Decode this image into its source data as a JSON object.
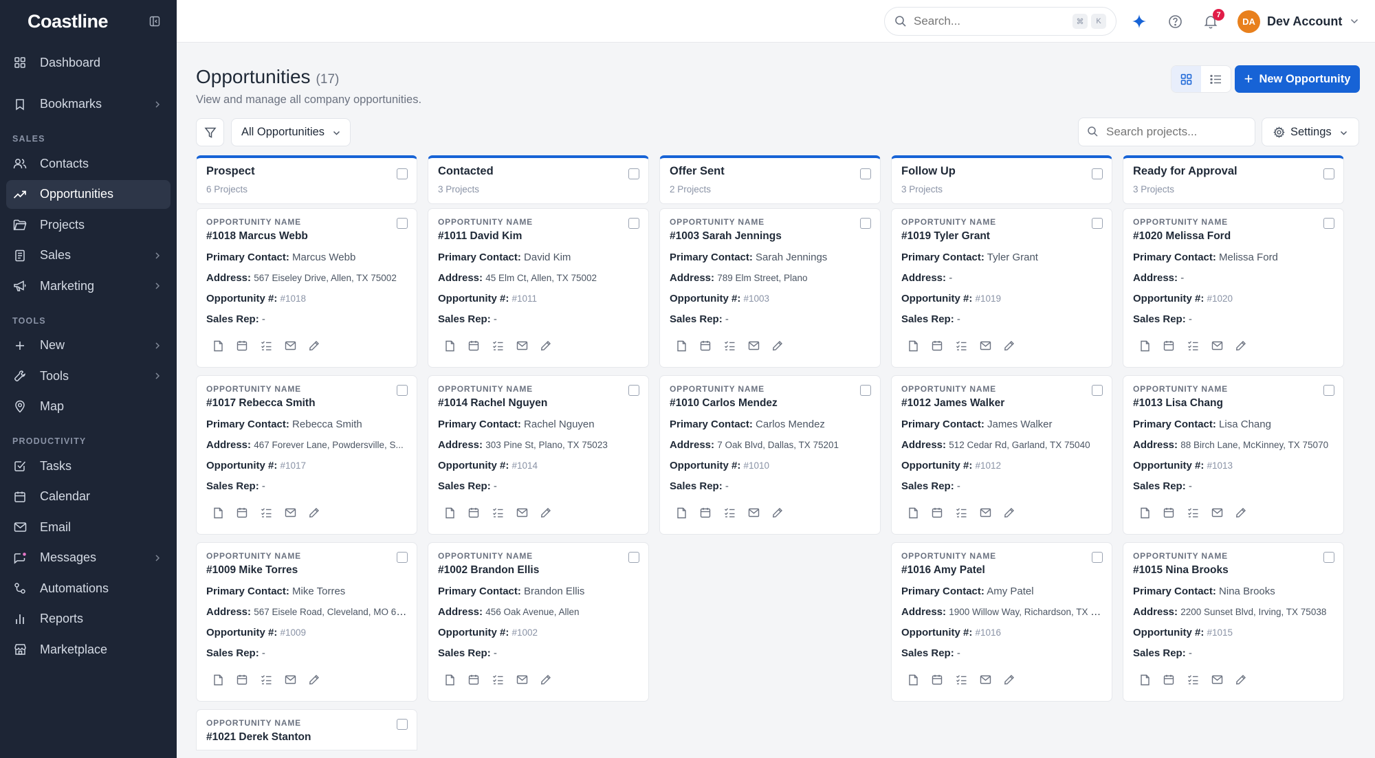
{
  "brand": {
    "name": "Coastline"
  },
  "sidebar": {
    "items_top": [
      {
        "label": "Dashboard",
        "icon": "grid-icon"
      },
      {
        "label": "Bookmarks",
        "icon": "bookmark-icon"
      }
    ],
    "section_sales": "SALES",
    "items_sales": [
      {
        "label": "Contacts",
        "icon": "users-icon"
      },
      {
        "label": "Opportunities",
        "icon": "trend-icon"
      },
      {
        "label": "Projects",
        "icon": "folder-icon"
      },
      {
        "label": "Sales",
        "icon": "receipt-icon"
      },
      {
        "label": "Marketing",
        "icon": "megaphone-icon"
      }
    ],
    "section_tools": "TOOLS",
    "items_tools": [
      {
        "label": "New",
        "icon": "plus-icon"
      },
      {
        "label": "Tools",
        "icon": "wrench-icon"
      },
      {
        "label": "Map",
        "icon": "map-pin-icon"
      }
    ],
    "section_productivity": "PRODUCTIVITY",
    "items_productivity": [
      {
        "label": "Tasks",
        "icon": "check-square-icon"
      },
      {
        "label": "Calendar",
        "icon": "calendar-icon"
      },
      {
        "label": "Email",
        "icon": "mail-icon"
      },
      {
        "label": "Messages",
        "icon": "message-icon"
      },
      {
        "label": "Automations",
        "icon": "automation-icon"
      },
      {
        "label": "Reports",
        "icon": "bar-chart-icon"
      },
      {
        "label": "Marketplace",
        "icon": "store-icon"
      }
    ]
  },
  "topbar": {
    "search_placeholder": "Search...",
    "kbd1": "⌘",
    "kbd2": "K",
    "notification_count": "7",
    "avatar_initials": "DA",
    "account_name": "Dev Account"
  },
  "page": {
    "title": "Opportunities",
    "count": "(17)",
    "subtitle": "View and manage all company opportunities.",
    "new_button": "New Opportunity",
    "filter_value": "All Opportunities",
    "project_search_placeholder": "Search projects...",
    "settings_label": "Settings"
  },
  "card_labels": {
    "kicker": "OPPORTUNITY NAME",
    "primary_contact": "Primary Contact:",
    "address": "Address:",
    "opportunity_no": "Opportunity #:",
    "sales_rep": "Sales Rep:"
  },
  "columns": [
    {
      "title": "Prospect",
      "count": "6 Projects",
      "cards": [
        {
          "name": "#1018 Marcus Webb",
          "contact": "Marcus Webb",
          "address": "567 Eiseley Drive, Allen, TX 75002",
          "opp": "#1018",
          "rep": "-"
        },
        {
          "name": "#1017 Rebecca Smith",
          "contact": "Rebecca Smith",
          "address": "467 Forever Lane, Powdersville, S...",
          "opp": "#1017",
          "rep": "-"
        },
        {
          "name": "#1009 Mike Torres",
          "contact": "Mike Torres",
          "address": "567 Eisele Road, Cleveland, MO 64...",
          "opp": "#1009",
          "rep": "-"
        },
        {
          "name": "#1021 Derek Stanton"
        }
      ]
    },
    {
      "title": "Contacted",
      "count": "3 Projects",
      "cards": [
        {
          "name": "#1011 David Kim",
          "contact": "David Kim",
          "address": "45 Elm Ct, Allen, TX 75002",
          "opp": "#1011",
          "rep": "-"
        },
        {
          "name": "#1014 Rachel Nguyen",
          "contact": "Rachel Nguyen",
          "address": "303 Pine St, Plano, TX 75023",
          "opp": "#1014",
          "rep": "-"
        },
        {
          "name": "#1002 Brandon Ellis",
          "contact": "Brandon Ellis",
          "address": "456 Oak Avenue, Allen",
          "opp": "#1002",
          "rep": "-"
        }
      ]
    },
    {
      "title": "Offer Sent",
      "count": "2 Projects",
      "cards": [
        {
          "name": "#1003 Sarah Jennings",
          "contact": "Sarah Jennings",
          "address": "789 Elm Street, Plano",
          "opp": "#1003",
          "rep": "-"
        },
        {
          "name": "#1010 Carlos Mendez",
          "contact": "Carlos Mendez",
          "address": "7 Oak Blvd, Dallas, TX 75201",
          "opp": "#1010",
          "rep": "-"
        }
      ]
    },
    {
      "title": "Follow Up",
      "count": "3 Projects",
      "cards": [
        {
          "name": "#1019 Tyler Grant",
          "contact": "Tyler Grant",
          "address": "-",
          "opp": "#1019",
          "rep": "-"
        },
        {
          "name": "#1012 James Walker",
          "contact": "James Walker",
          "address": "512 Cedar Rd, Garland, TX 75040",
          "opp": "#1012",
          "rep": "-"
        },
        {
          "name": "#1016 Amy Patel",
          "contact": "Amy Patel",
          "address": "1900 Willow Way, Richardson, TX 7...",
          "opp": "#1016",
          "rep": "-"
        }
      ]
    },
    {
      "title": "Ready for Approval",
      "count": "3 Projects",
      "cards": [
        {
          "name": "#1020 Melissa Ford",
          "contact": "Melissa Ford",
          "address": "-",
          "opp": "#1020",
          "rep": "-"
        },
        {
          "name": "#1013 Lisa Chang",
          "contact": "Lisa Chang",
          "address": "88 Birch Lane, McKinney, TX 75070",
          "opp": "#1013",
          "rep": "-"
        },
        {
          "name": "#1015 Nina Brooks",
          "contact": "Nina Brooks",
          "address": "2200 Sunset Blvd, Irving, TX 75038",
          "opp": "#1015",
          "rep": "-"
        }
      ]
    }
  ],
  "colors": {
    "accent": "#1763d6",
    "sidebar_bg": "#1d2535",
    "badge": "#e11d48",
    "avatar": "#e8801d"
  }
}
